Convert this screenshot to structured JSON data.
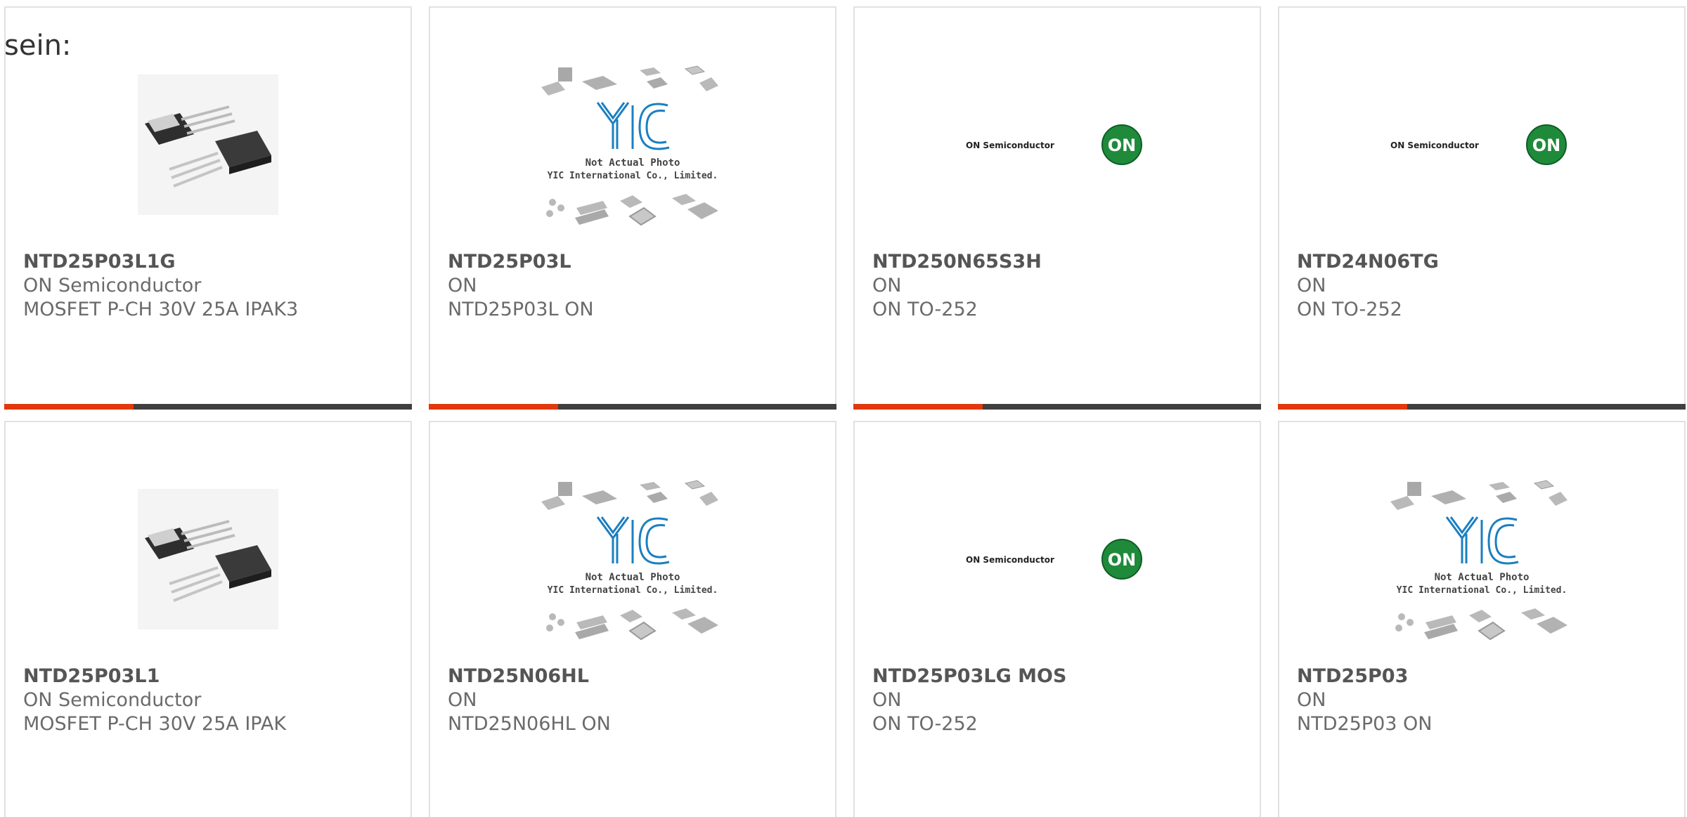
{
  "lead_text": "sein:",
  "colors": {
    "accent": "#e2380b",
    "bar": "#3f3f3f",
    "on_green": "#1f8a3a",
    "yic_blue": "#1b7fc1"
  },
  "cards": [
    {
      "part": "NTD25P03L1G",
      "maker": "ON Semiconductor",
      "desc": "MOSFET P-CH 30V 25A IPAK3",
      "image": "to251-package-icon"
    },
    {
      "part": "NTD25P03L",
      "maker": "ON",
      "desc": "NTD25P03L ON",
      "image": "yic-placeholder-icon",
      "image_caption_1": "Not Actual Photo",
      "image_caption_2": "YIC International Co., Limited."
    },
    {
      "part": "NTD250N65S3H",
      "maker": "ON",
      "desc": "ON TO-252",
      "image": "on-semiconductor-logo",
      "logo_text": "ON Semiconductor",
      "logo_mark": "ON"
    },
    {
      "part": "NTD24N06TG",
      "maker": "ON",
      "desc": "ON TO-252",
      "image": "on-semiconductor-logo",
      "logo_text": "ON Semiconductor",
      "logo_mark": "ON"
    },
    {
      "part": "NTD25P03L1",
      "maker": "ON Semiconductor",
      "desc": "MOSFET P-CH 30V 25A IPAK",
      "image": "to251-package-icon"
    },
    {
      "part": "NTD25N06HL",
      "maker": "ON",
      "desc": "NTD25N06HL ON",
      "image": "yic-placeholder-icon",
      "image_caption_1": "Not Actual Photo",
      "image_caption_2": "YIC International Co., Limited."
    },
    {
      "part": "NTD25P03LG MOS",
      "maker": "ON",
      "desc": "ON TO-252",
      "image": "on-semiconductor-logo",
      "logo_text": "ON Semiconductor",
      "logo_mark": "ON"
    },
    {
      "part": "NTD25P03",
      "maker": "ON",
      "desc": "NTD25P03 ON",
      "image": "yic-placeholder-icon",
      "image_caption_1": "Not Actual Photo",
      "image_caption_2": "YIC International Co., Limited."
    }
  ]
}
